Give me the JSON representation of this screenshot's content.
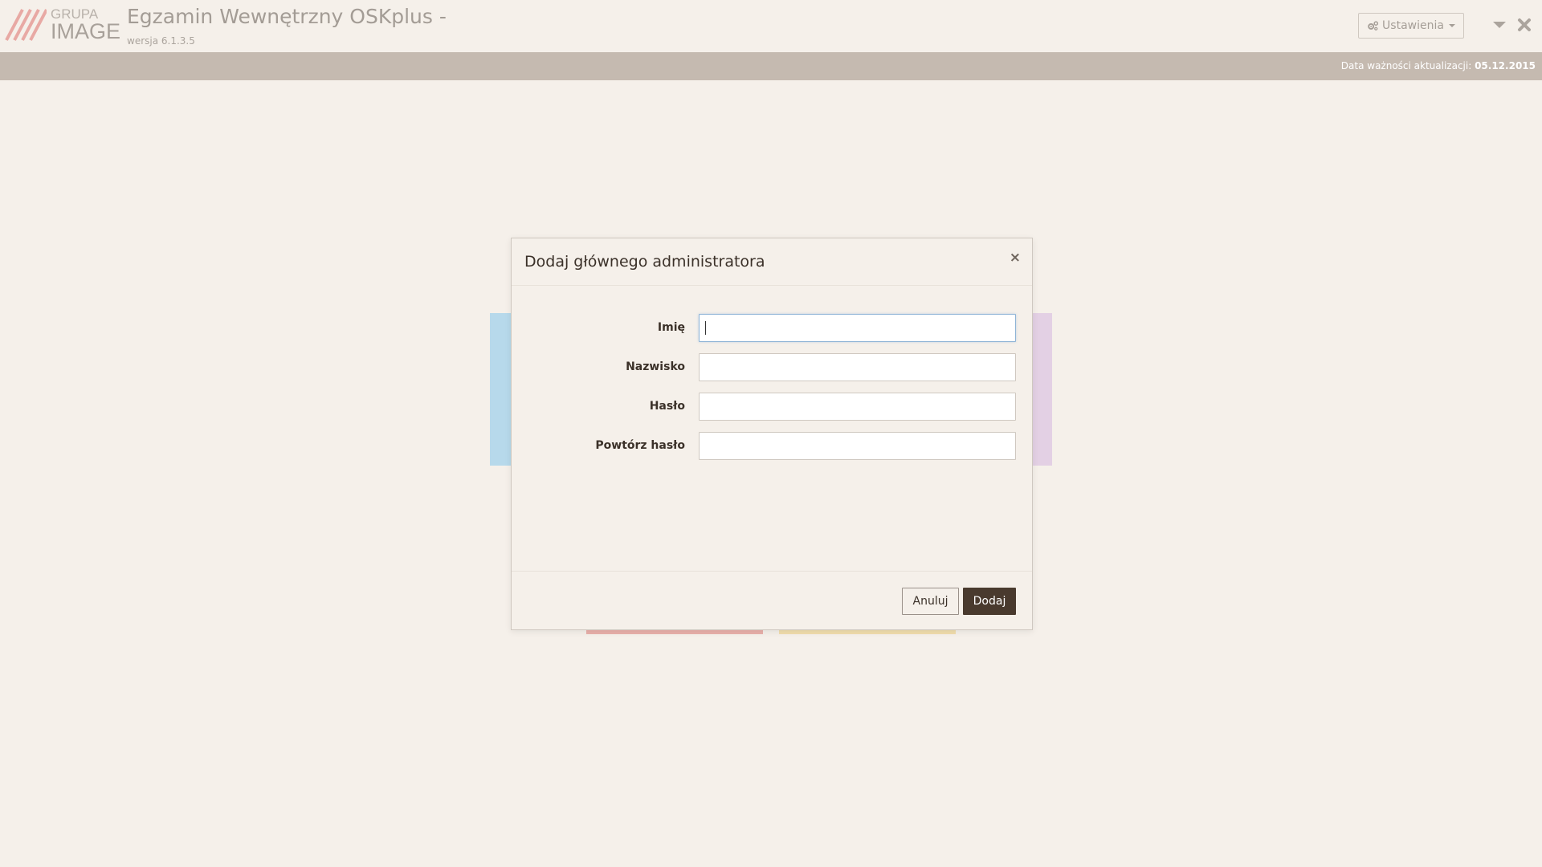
{
  "app": {
    "logo_top": "GRUPA",
    "logo_bottom": "IMAGE",
    "title": "Egzamin Wewnętrzny OSKplus -",
    "version": "wersja 6.1.3.5"
  },
  "header": {
    "settings_label": "Ustawienia",
    "settings_icon": "gears-icon",
    "minimize_icon": "chevron-down-icon",
    "close_icon": "close-icon"
  },
  "info_bar": {
    "label": "Data ważności aktualizacji: ",
    "date": "05.12.2015"
  },
  "modal": {
    "title": "Dodaj głównego administratora",
    "close_symbol": "×",
    "fields": [
      {
        "label": "Imię",
        "value": "",
        "placeholder": ""
      },
      {
        "label": "Nazwisko",
        "value": "",
        "placeholder": ""
      },
      {
        "label": "Hasło",
        "value": "",
        "placeholder": ""
      },
      {
        "label": "Powtórz hasło",
        "value": "",
        "placeholder": ""
      }
    ],
    "cancel_label": "Anuluj",
    "submit_label": "Dodaj"
  },
  "colors": {
    "background": "#f5f0ea",
    "info_bar": "#c5bab0",
    "primary_button": "#493a2e",
    "logo_stripes": "#e8a9a4",
    "tile_blue": "#b7d9eb",
    "tile_purple": "#e3d0e4",
    "tile_red": "#e9b0aa",
    "tile_yellow": "#f1ddad"
  }
}
